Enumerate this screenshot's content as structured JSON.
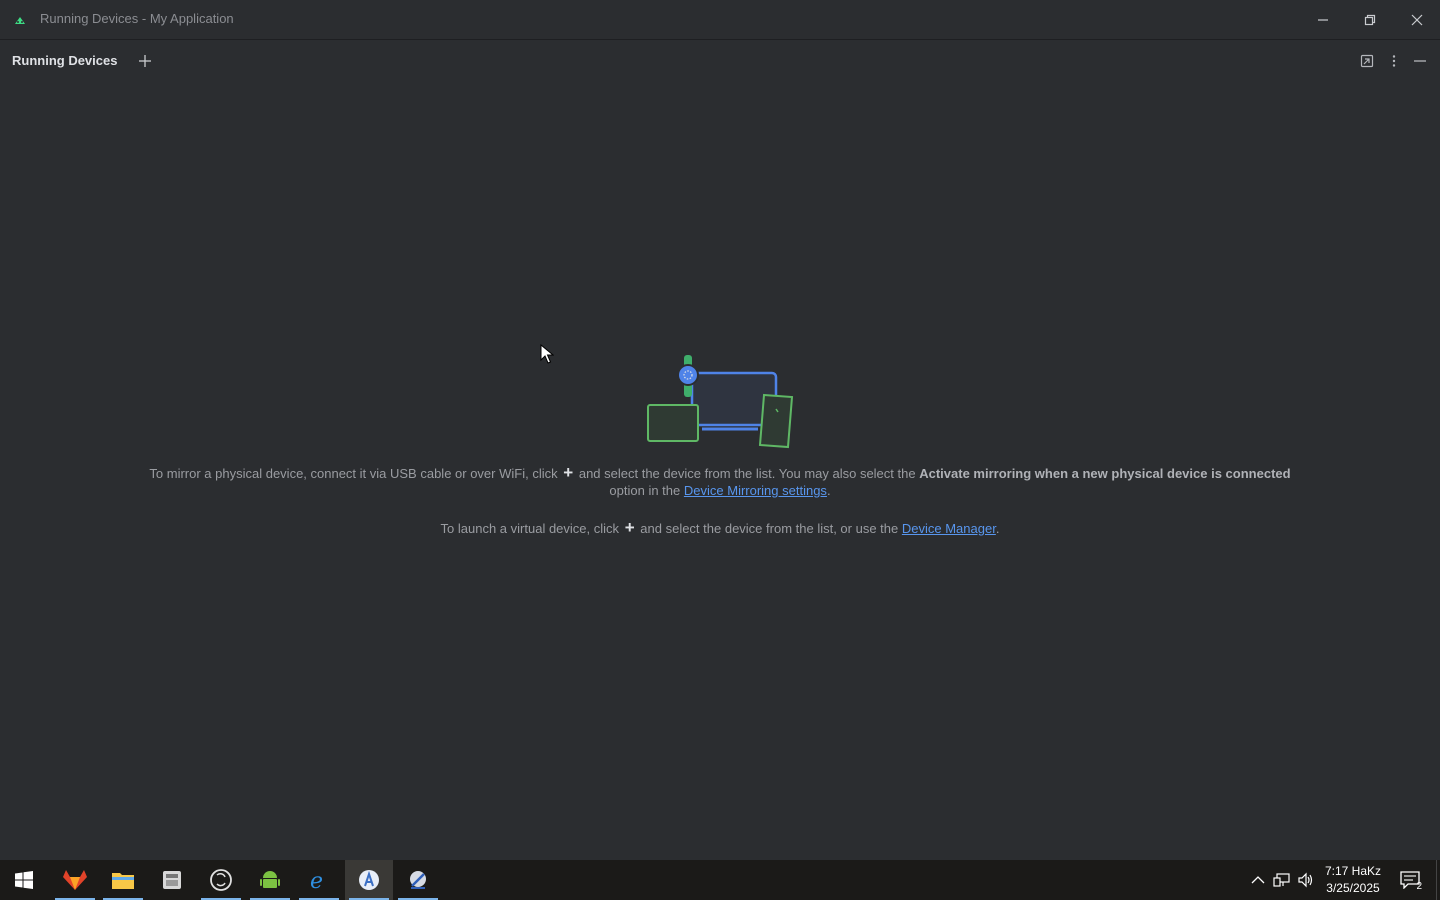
{
  "window": {
    "title": "Running Devices - My Application"
  },
  "toolwindow": {
    "tab_label": "Running Devices",
    "add_tab_icon": "plus-icon",
    "actions": [
      "restore-layout-icon",
      "more-vert-icon",
      "hide-icon"
    ]
  },
  "empty_state": {
    "line1_a": "To mirror a physical device, connect it via USB cable or over WiFi, click",
    "line1_b": "and select the device from the list. You may also select the",
    "line1_bold": "Activate mirroring when a new physical device is connected",
    "line1_c": "option in the",
    "line1_link": "Device Mirroring settings",
    "line1_end": ".",
    "line2_a": "To launch a virtual device, click",
    "line2_b": "and select the device from the list, or use the",
    "line2_link": "Device Manager",
    "line2_end": "."
  },
  "taskbar": {
    "items": [
      {
        "name": "start-icon"
      },
      {
        "name": "gitlab-icon"
      },
      {
        "name": "file-explorer-icon"
      },
      {
        "name": "archive-icon"
      },
      {
        "name": "obs-icon"
      },
      {
        "name": "android-icon"
      },
      {
        "name": "edge-icon"
      },
      {
        "name": "android-studio-icon"
      },
      {
        "name": "remote-icon"
      }
    ],
    "clock_time": "7:17 HaKz",
    "clock_date": "3/25/2025",
    "notification_count": "2"
  },
  "colors": {
    "background": "#2b2d30",
    "taskbar": "#1b1a18",
    "link": "#5896ee",
    "accent_green": "#5fb865",
    "accent_blue": "#4f83e8"
  }
}
